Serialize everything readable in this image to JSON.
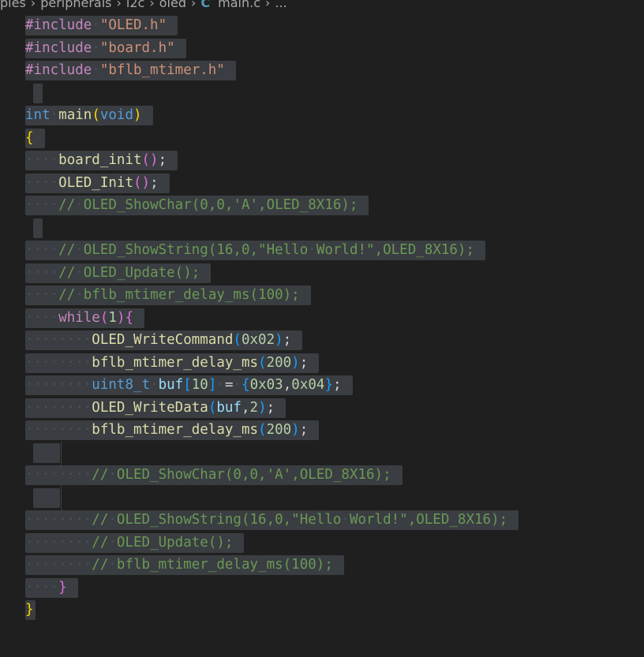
{
  "breadcrumb": {
    "parts": [
      "ples",
      "peripherals",
      "i2c",
      "oled"
    ],
    "file": "main.c",
    "tail": "..."
  },
  "icons": {
    "file_type": "c-language-icon",
    "separator": "chevron-right-icon"
  },
  "colors": {
    "background": "#1f1f1f",
    "selection": "#3a3d41",
    "comment": "#6a9955",
    "string": "#ce9178",
    "keyword": "#569cd6",
    "function": "#dcdcaa"
  },
  "code": {
    "l1": {
      "kw": "#include",
      "str": "\"OLED.h\""
    },
    "l2": {
      "kw": "#include",
      "str": "\"board.h\""
    },
    "l3": {
      "kw": "#include",
      "str": "\"bflb_mtimer.h\""
    },
    "l5": {
      "type": "int",
      "fn": "main",
      "param": "void"
    },
    "l6": {
      "brace": "{"
    },
    "l7": {
      "fn": "board_init",
      "end": ";"
    },
    "l8": {
      "fn": "OLED_Init",
      "end": ";"
    },
    "l9": {
      "comment": "// OLED_ShowChar(0,0,'A',OLED_8X16);"
    },
    "l11": {
      "comment": "// OLED_ShowString(16,0,\"Hello World!\",OLED_8X16);"
    },
    "l12": {
      "comment": "// OLED_Update();"
    },
    "l13": {
      "comment": "// bflb_mtimer_delay_ms(100);"
    },
    "l14": {
      "kw": "while",
      "num": "1",
      "brace": "{"
    },
    "l15": {
      "fn": "OLED_WriteCommand",
      "num": "0x02",
      "end": ";"
    },
    "l16": {
      "fn": "bflb_mtimer_delay_ms",
      "num": "200",
      "end": ";"
    },
    "l17": {
      "type": "uint8_t",
      "var": "buf",
      "num": "10",
      "eq": " = ",
      "v1": "0x03",
      "comma": ",",
      "v2": "0x04",
      "end": ";"
    },
    "l18": {
      "fn": "OLED_WriteData",
      "var": "buf",
      "comma": ",",
      "num": "2",
      "end": ";"
    },
    "l19": {
      "fn": "bflb_mtimer_delay_ms",
      "num": "200",
      "end": ";"
    },
    "l21": {
      "comment": "// OLED_ShowChar(0,0,'A',OLED_8X16);"
    },
    "l23": {
      "comment": "// OLED_ShowString(16,0,\"Hello World!\",OLED_8X16);"
    },
    "l24": {
      "comment": "// OLED_Update();"
    },
    "l25": {
      "comment": "// bflb_mtimer_delay_ms(100);"
    },
    "l26": {
      "brace": "}"
    },
    "l27": {
      "brace": "}"
    }
  }
}
